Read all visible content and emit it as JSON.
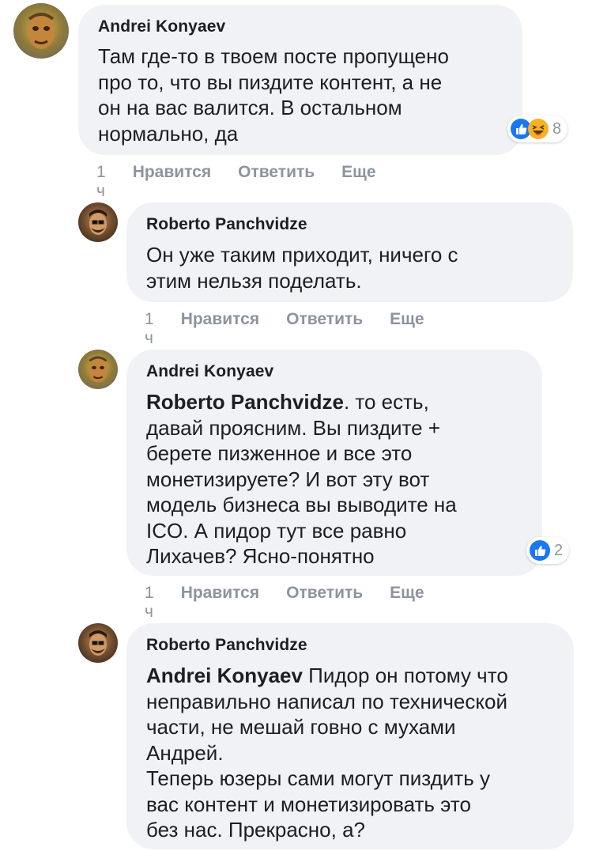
{
  "colors": {
    "bubble_bg": "#f0f2f5",
    "meta_text": "#8d949e",
    "like_blue": "#1877f2",
    "haha_yellow": "#f7b125"
  },
  "comments": [
    {
      "author": "Andrei Konyaev",
      "text": "Там где-то в твоем посте пропущено\nпро то, что вы пиздите контент, а не\nон на вас валится. В остальном\nнормально, да",
      "mention": "",
      "time": "1 ч",
      "like_label": "Нравится",
      "reply_label": "Ответить",
      "more_label": "Еще",
      "reactions": [
        "like-icon",
        "haha-icon"
      ],
      "reaction_count": "8"
    },
    {
      "author": "Roberto Panchvidze",
      "text": "Он уже таким приходит, ничего с\nэтим нельзя поделать.",
      "mention": "",
      "time": "1 ч",
      "like_label": "Нравится",
      "reply_label": "Ответить",
      "more_label": "Еще"
    },
    {
      "author": "Andrei Konyaev",
      "mention": "Roberto Panchvidze",
      "text": ". то есть,\nдавай проясним. Вы пиздите +\nберете пизженное и все это\nмонетизируете? И вот эту вот\nмодель бизнеса вы выводите на\nICO. А пидор тут все равно\nЛихачев? Ясно-понятно",
      "time": "1 ч",
      "like_label": "Нравится",
      "reply_label": "Ответить",
      "more_label": "Еще",
      "reactions": [
        "like-icon"
      ],
      "reaction_count": "2"
    },
    {
      "author": "Roberto Panchvidze",
      "mention": "Andrei Konyaev",
      "text": " Пидор он потому что\nнеправильно написал по технической\nчасти, не мешай говно с мухами\nАндрей.\nТеперь юзеры сами могут пиздить у\nвас контент и монетизировать это\nбез нас. Прекрасно, а?"
    }
  ]
}
